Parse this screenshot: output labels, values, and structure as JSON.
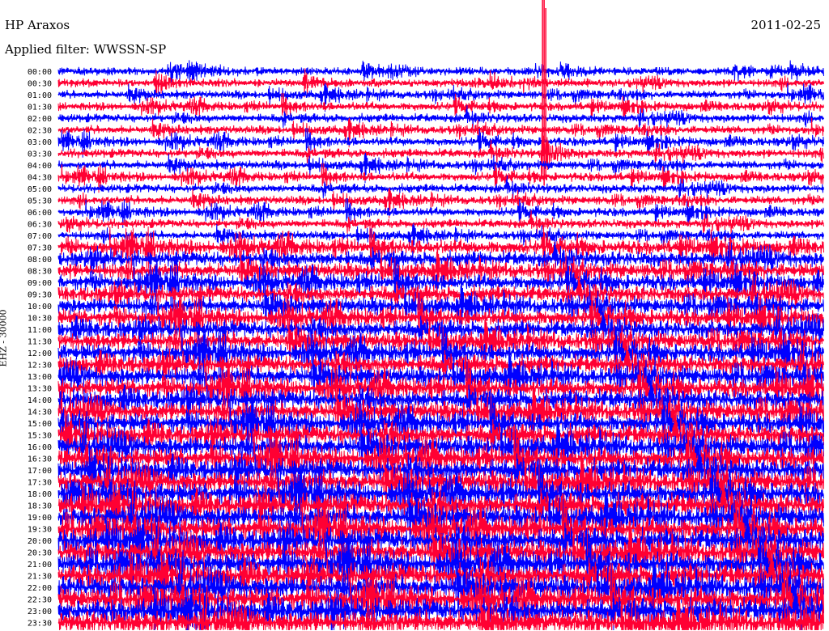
{
  "header": {
    "station": "HP Araxos",
    "date": "2011-02-25",
    "filter": "Applied filter: WWSSN-SP",
    "channel": "EHZ - 30000"
  },
  "chart_data": {
    "type": "line",
    "title": "HP Araxos",
    "subtitle": "Applied filter: WWSSN-SP",
    "ylabel": "EHZ - 30000",
    "xlabel": "",
    "row_interval_minutes": 30,
    "rows": [
      "00:00",
      "00:30",
      "01:00",
      "01:30",
      "02:00",
      "02:30",
      "03:00",
      "03:30",
      "04:00",
      "04:30",
      "05:00",
      "05:30",
      "06:00",
      "06:30",
      "07:00",
      "07:30",
      "08:00",
      "08:30",
      "09:00",
      "09:30",
      "10:00",
      "10:30",
      "11:00",
      "11:30",
      "12:00",
      "12:30",
      "13:00",
      "13:30",
      "14:00",
      "14:30",
      "15:00",
      "15:30",
      "16:00",
      "16:30",
      "17:00",
      "17:30",
      "18:00",
      "18:30",
      "19:00",
      "19:30",
      "20:00",
      "20:30",
      "21:00",
      "21:30",
      "22:00",
      "22:30",
      "23:00",
      "23:30"
    ],
    "series": [
      {
        "color": "#0000ff"
      },
      {
        "color": "#ff0033"
      }
    ],
    "row_amplitude_level": [
      0.25,
      0.25,
      0.26,
      0.27,
      0.27,
      0.27,
      0.28,
      0.28,
      0.28,
      0.28,
      0.28,
      0.28,
      0.28,
      0.28,
      0.28,
      0.55,
      0.58,
      0.6,
      0.62,
      0.63,
      0.65,
      0.67,
      0.68,
      0.7,
      0.72,
      0.73,
      0.75,
      0.76,
      0.78,
      0.79,
      0.8,
      0.82,
      0.84,
      0.86,
      0.88,
      0.9,
      0.92,
      0.93,
      0.94,
      0.95,
      0.96,
      0.96,
      0.97,
      0.97,
      0.98,
      0.98,
      0.99,
      1.0
    ],
    "event": {
      "row": "03:30",
      "minute_in_row": 19,
      "peak_level": 6
    }
  }
}
